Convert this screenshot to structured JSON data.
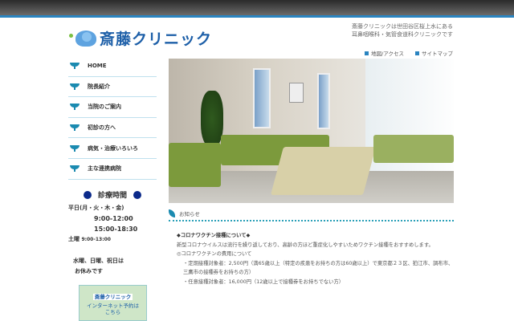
{
  "header": {
    "logo_text": "斎藤クリニック",
    "tagline": [
      "斎藤クリニックは世田谷区桜上水にある",
      "耳鼻咽喉科・気管食道科クリニックです"
    ],
    "links": [
      "地図/アクセス",
      "サイトマップ"
    ]
  },
  "nav": [
    "HOME",
    "院長紹介",
    "当院のご案内",
    "初診の方へ",
    "病気・治療いろいろ",
    "主な連携病院"
  ],
  "hours": {
    "title": "診療時間",
    "weekday": "平日(月・火・木・金)",
    "am": "9:00-12:00",
    "pm": "15:00-18:30",
    "sat_label": "土曜",
    "sat": "9:00-13:00",
    "closed1": "水曜、日曜、祝日は",
    "closed2": "お休みです"
  },
  "banner": {
    "logo": "斎藤クリニック",
    "text1": "インターネット予約は",
    "text2": "こちら"
  },
  "notice": {
    "heading": "お知らせ",
    "title": "◆コロナワクチン接種について◆",
    "p1": "新型コロナウイルスは流行を繰り返しており、高齢の方ほど重症化しやすいためワクチン接種をおすすめします。",
    "p2": "◎コロナワクチンの費用について",
    "p3": "・定期接種対象者：2,500円（満65歳以上（特定の疾患をお持ちの方は60歳以上）で東京都２３区、狛江市、調布市、三鷹市の接種券をお持ちの方）",
    "p4": "・任意接種対象者：16,000円（12歳以上で接種券をお持ちでない方）"
  }
}
